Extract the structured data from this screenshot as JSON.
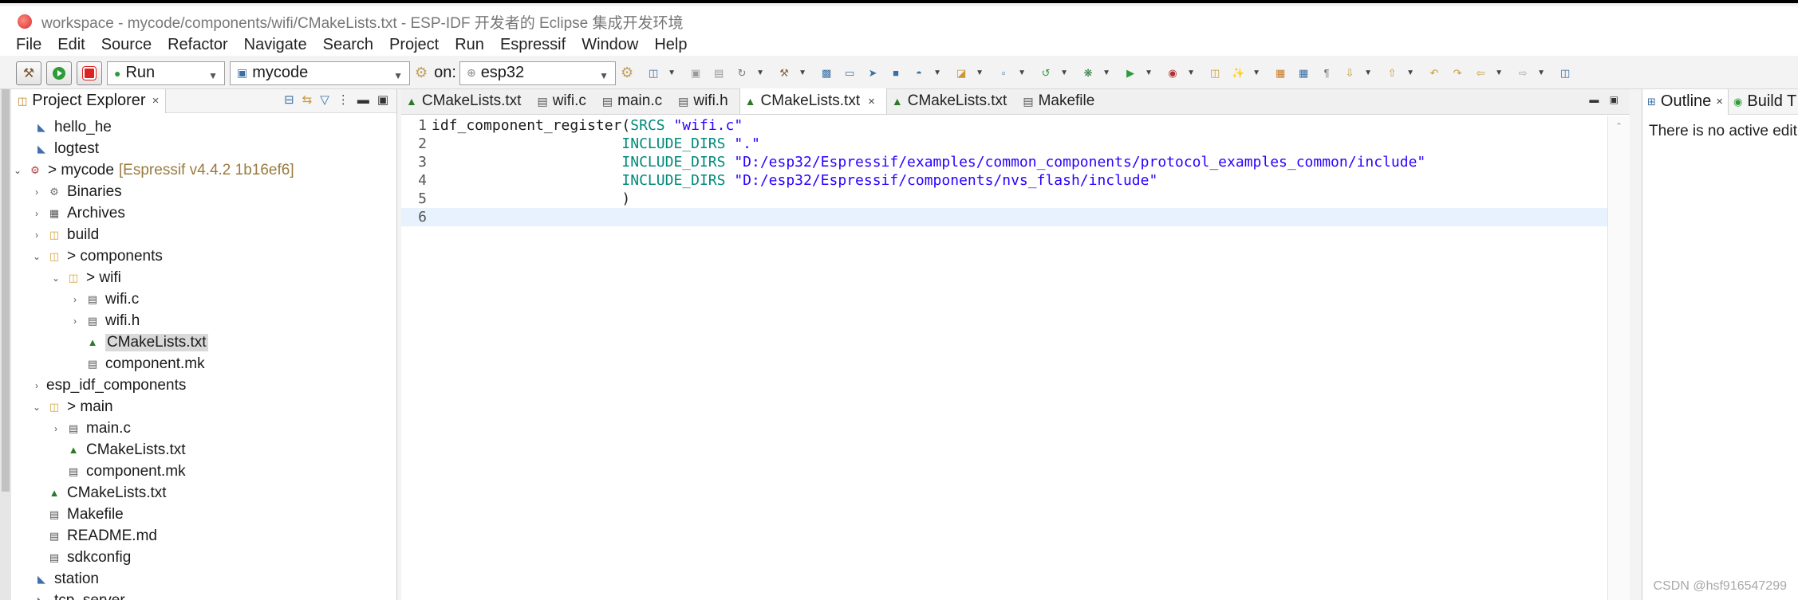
{
  "window": {
    "title": "workspace - mycode/components/wifi/CMakeLists.txt - ESP-IDF 开发者的 Eclipse 集成开发环境"
  },
  "menu": [
    "File",
    "Edit",
    "Source",
    "Refactor",
    "Navigate",
    "Search",
    "Project",
    "Run",
    "Espressif",
    "Window",
    "Help"
  ],
  "toolbar": {
    "build_icon": "hammer-icon",
    "run_icon": "run-icon",
    "stop_icon": "stop-icon",
    "launch_mode": "Run",
    "launch_config": "mycode",
    "on_label": "on:",
    "target": "esp32"
  },
  "explorer": {
    "tab_label": "Project Explorer",
    "close": "×",
    "items": [
      {
        "label": "hello_he",
        "extra": ""
      },
      {
        "label": "logtest",
        "extra": ""
      },
      {
        "label": "> mycode",
        "extra": "[Espressif v4.4.2 1b16ef6]"
      },
      {
        "label": "Binaries",
        "extra": ""
      },
      {
        "label": "Archives",
        "extra": ""
      },
      {
        "label": "build",
        "extra": ""
      },
      {
        "label": "> components",
        "extra": ""
      },
      {
        "label": "> wifi",
        "extra": ""
      },
      {
        "label": "wifi.c",
        "extra": ""
      },
      {
        "label": "wifi.h",
        "extra": ""
      },
      {
        "label": "CMakeLists.txt",
        "extra": ""
      },
      {
        "label": "component.mk",
        "extra": ""
      },
      {
        "label": "esp_idf_components",
        "extra": ""
      },
      {
        "label": "> main",
        "extra": ""
      },
      {
        "label": "main.c",
        "extra": ""
      },
      {
        "label": "CMakeLists.txt",
        "extra": ""
      },
      {
        "label": "component.mk",
        "extra": ""
      },
      {
        "label": "CMakeLists.txt",
        "extra": ""
      },
      {
        "label": "Makefile",
        "extra": ""
      },
      {
        "label": "README.md",
        "extra": ""
      },
      {
        "label": "sdkconfig",
        "extra": ""
      },
      {
        "label": "station",
        "extra": ""
      },
      {
        "label": "tcp_server",
        "extra": ""
      }
    ]
  },
  "editor": {
    "tabs": [
      {
        "label": "CMakeLists.txt",
        "close": ""
      },
      {
        "label": "wifi.c",
        "close": ""
      },
      {
        "label": "main.c",
        "close": ""
      },
      {
        "label": "wifi.h",
        "close": ""
      },
      {
        "label": "CMakeLists.txt",
        "close": "×"
      },
      {
        "label": "CMakeLists.txt",
        "close": ""
      },
      {
        "label": "Makefile",
        "close": ""
      }
    ],
    "lines": [
      {
        "num": "1",
        "fn": "idf_component_register",
        "p1": "(",
        "kw": "SRCS",
        "str": "\"wifi.c\"",
        "indent": ""
      },
      {
        "num": "2",
        "fn": "",
        "p1": "",
        "kw": "INCLUDE_DIRS",
        "str": "\".\"",
        "indent": "                      "
      },
      {
        "num": "3",
        "fn": "",
        "p1": "",
        "kw": "INCLUDE_DIRS",
        "str": "\"D:/esp32/Espressif/examples/common_components/protocol_examples_common/include\"",
        "indent": "                      "
      },
      {
        "num": "4",
        "fn": "",
        "p1": "",
        "kw": "INCLUDE_DIRS",
        "str": "\"D:/esp32/Espressif/components/nvs_flash/include\"",
        "indent": "                      "
      },
      {
        "num": "5",
        "fn": "",
        "p1": ")",
        "kw": "",
        "str": "",
        "indent": "                      "
      },
      {
        "num": "6",
        "fn": "",
        "p1": "",
        "kw": "",
        "str": "",
        "indent": ""
      }
    ]
  },
  "outline": {
    "tab_label": "Outline",
    "close": "×",
    "build_tab_label": "Build T",
    "message": "There is no active edit"
  },
  "watermark": "CSDN @hsf916547299"
}
